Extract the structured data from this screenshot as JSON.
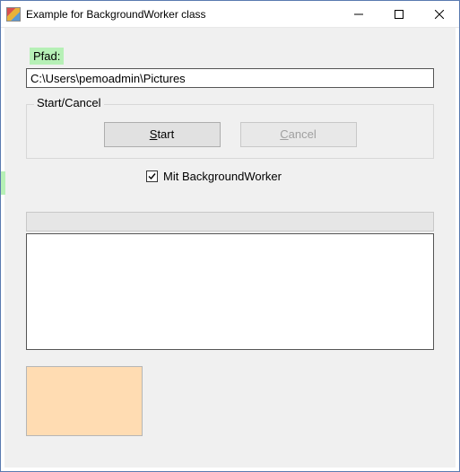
{
  "window": {
    "title": "Example for BackgroundWorker class"
  },
  "labels": {
    "pfad": "Pfad:"
  },
  "path_input": {
    "value": "C:\\Users\\pemoadmin\\Pictures"
  },
  "group": {
    "legend": "Start/Cancel",
    "start_prefix": "S",
    "start_rest": "tart",
    "cancel_prefix": "C",
    "cancel_rest": "ancel"
  },
  "checkbox": {
    "checked": true,
    "label": "Mit BackgroundWorker"
  },
  "colors": {
    "swatch": "#ffdcb2",
    "highlight": "#b6f0b6"
  }
}
